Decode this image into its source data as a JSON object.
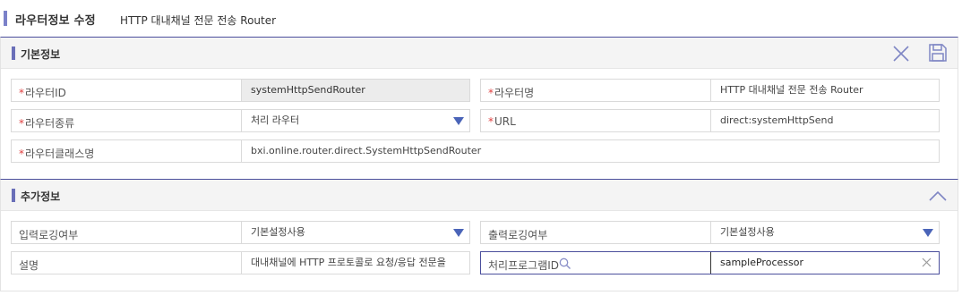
{
  "header": {
    "title": "라우터정보 수정",
    "subtitle": "HTTP 대내채널 전문 전송 Router"
  },
  "basic_section": {
    "title": "기본정보",
    "actions": [
      "close-icon",
      "save-icon"
    ],
    "fields": {
      "router_id": {
        "label": "라우터ID",
        "required": "*",
        "value": "systemHttpSendRouter"
      },
      "router_name": {
        "label": "라우터명",
        "required": "*",
        "value": "HTTP 대내채널 전문 전송 Router"
      },
      "router_type": {
        "label": "라우터종류",
        "required": "*",
        "value": "처리 라우터"
      },
      "url": {
        "label": "URL",
        "required": "*",
        "value": "direct:systemHttpSend"
      },
      "router_class": {
        "label": "라우터클래스명",
        "required": "*",
        "value": "bxi.online.router.direct.SystemHttpSendRouter"
      }
    }
  },
  "extra_section": {
    "title": "추가정보",
    "toggle_icon": "chevron-up-icon",
    "fields": {
      "input_logging": {
        "label": "입력로깅여부",
        "value": "기본설정사용"
      },
      "output_logging": {
        "label": "출력로깅여부",
        "value": "기본설정사용"
      },
      "description": {
        "label": "설명",
        "value": "대내채널에 HTTP 프로토콜로 요청/응답 전문을"
      },
      "processor_id": {
        "label": "처리프로그램ID",
        "value": "sampleProcessor"
      }
    }
  },
  "colors": {
    "accent": "#4b4f9c",
    "required": "#e04040",
    "caret": "#4a64b8"
  }
}
